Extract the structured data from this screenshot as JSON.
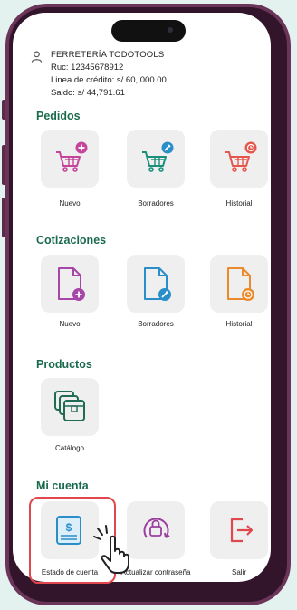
{
  "account": {
    "name": "FERRETERÍA TODOTOOLS",
    "ruc": "Ruc: 12345678912",
    "credit_line": "Linea de crédito: s/ 60, 000.00",
    "balance": "Saldo: s/ 44,791.61"
  },
  "sections": {
    "pedidos": {
      "title": "Pedidos",
      "items": [
        {
          "label": "Nuevo",
          "icon": "cart-add-icon"
        },
        {
          "label": "Borradores",
          "icon": "cart-edit-icon"
        },
        {
          "label": "Historial",
          "icon": "cart-history-icon"
        }
      ]
    },
    "cotizaciones": {
      "title": "Cotizaciones",
      "items": [
        {
          "label": "Nuevo",
          "icon": "document-add-icon"
        },
        {
          "label": "Borradores",
          "icon": "document-edit-icon"
        },
        {
          "label": "Historial",
          "icon": "document-history-icon"
        }
      ]
    },
    "productos": {
      "title": "Productos",
      "items": [
        {
          "label": "Catálogo",
          "icon": "catalog-icon"
        }
      ]
    },
    "mi_cuenta": {
      "title": "Mi cuenta",
      "items": [
        {
          "label": "Estado de cuenta",
          "icon": "account-statement-icon"
        },
        {
          "label": "Actualizar contraseña",
          "icon": "password-reset-icon"
        },
        {
          "label": "Salir",
          "icon": "logout-icon"
        }
      ]
    }
  },
  "colors": {
    "section_title": "#1a6b4d",
    "pedidos_accent": "#c4469a",
    "editar_accent": "#2a8fc9",
    "historial_accent": "#e5564d",
    "cotizacion_nuevo": "#a646a8",
    "cotizacion_historial": "#e98b2c",
    "catalogo": "#1f6b54",
    "cuenta": "#2a8fc9",
    "password": "#9a3fa0",
    "salir": "#e0484d",
    "highlight": "#e0484d"
  }
}
